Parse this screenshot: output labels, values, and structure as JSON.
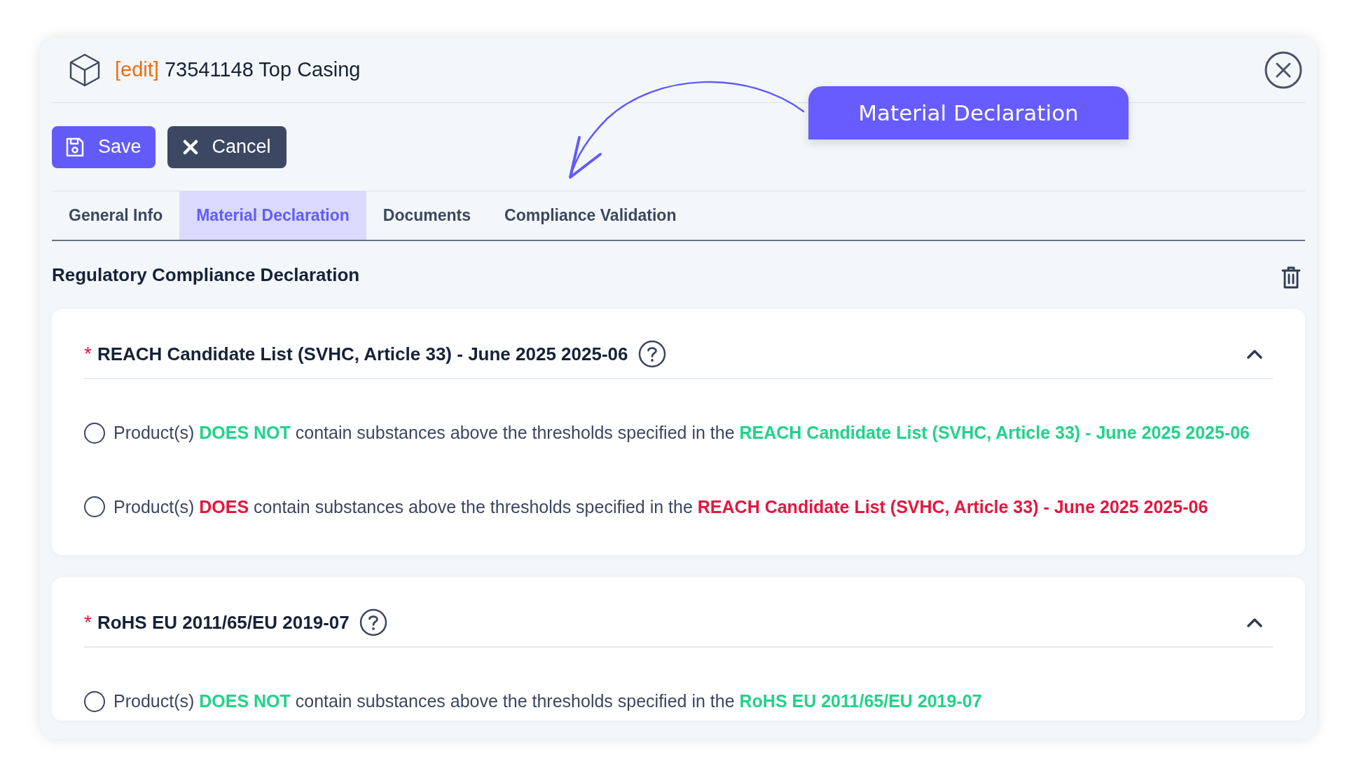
{
  "header": {
    "tag": "[edit]",
    "title": "73541148 Top Casing"
  },
  "actions": [
    {
      "kind": "save",
      "label": "Save"
    },
    {
      "kind": "cancel",
      "label": "Cancel"
    }
  ],
  "callout": {
    "label": "Material Declaration"
  },
  "tabs": [
    {
      "label": "General Info",
      "selected": false
    },
    {
      "label": "Material Declaration",
      "selected": true
    },
    {
      "label": "Documents",
      "selected": false
    },
    {
      "label": "Compliance Validation",
      "selected": false
    }
  ],
  "section_title": "Regulatory Compliance Declaration",
  "declarations": [
    {
      "required_mark": "*",
      "title": "REACH Candidate List (SVHC, Article 33) - June 2025 2025-06",
      "expanded": true,
      "options": [
        {
          "selected": false,
          "parts": [
            {
              "kind": "plain",
              "text": "Product(s) "
            },
            {
              "kind": "positive",
              "text": "DOES NOT"
            },
            {
              "kind": "plain",
              "text": " contain substances above the thresholds specified in the "
            },
            {
              "kind": "positive",
              "text": "REACH Candidate List (SVHC, Article 33) - June 2025 2025-06"
            }
          ]
        },
        {
          "selected": false,
          "parts": [
            {
              "kind": "plain",
              "text": "Product(s) "
            },
            {
              "kind": "negative",
              "text": "DOES"
            },
            {
              "kind": "plain",
              "text": " contain substances above the thresholds specified in the "
            },
            {
              "kind": "negative",
              "text": "REACH Candidate List (SVHC, Article 33) - June 2025 2025-06"
            }
          ]
        }
      ]
    },
    {
      "required_mark": "*",
      "title": "RoHS EU 2011/65/EU 2019-07",
      "expanded": true,
      "options": [
        {
          "selected": false,
          "parts": [
            {
              "kind": "plain",
              "text": "Product(s) "
            },
            {
              "kind": "positive",
              "text": "DOES NOT"
            },
            {
              "kind": "plain",
              "text": " contain substances above the thresholds specified in the "
            },
            {
              "kind": "positive",
              "text": "RoHS EU 2011/65/EU 2019-07"
            }
          ]
        }
      ]
    }
  ]
}
